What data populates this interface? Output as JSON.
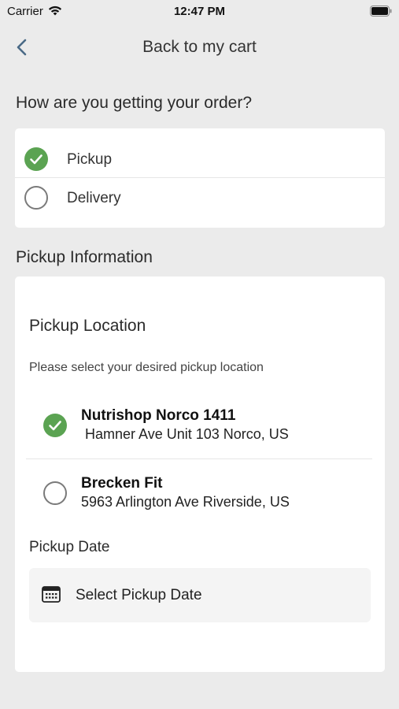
{
  "status_bar": {
    "carrier": "Carrier",
    "time": "12:47 PM"
  },
  "nav": {
    "title": "Back to my cart",
    "back_icon": "chevron-left-icon"
  },
  "order_method": {
    "title": "How are you getting your order?",
    "options": [
      {
        "label": "Pickup",
        "selected": true
      },
      {
        "label": "Delivery",
        "selected": false
      }
    ]
  },
  "pickup_info": {
    "title": "Pickup Information",
    "location_title": "Pickup Location",
    "location_prompt": "Please select your desired pickup location",
    "locations": [
      {
        "name": "Nutrishop Norco 1411",
        "address": " Hamner Ave Unit 103 Norco, US",
        "selected": true
      },
      {
        "name": "Brecken Fit",
        "address": "5963 Arlington Ave Riverside, US",
        "selected": false
      }
    ],
    "date_title": "Pickup Date",
    "date_placeholder": "Select Pickup Date",
    "date_icon": "calendar-icon"
  },
  "colors": {
    "accent_green": "#5ba352",
    "background": "#ebebeb",
    "card": "#ffffff"
  }
}
